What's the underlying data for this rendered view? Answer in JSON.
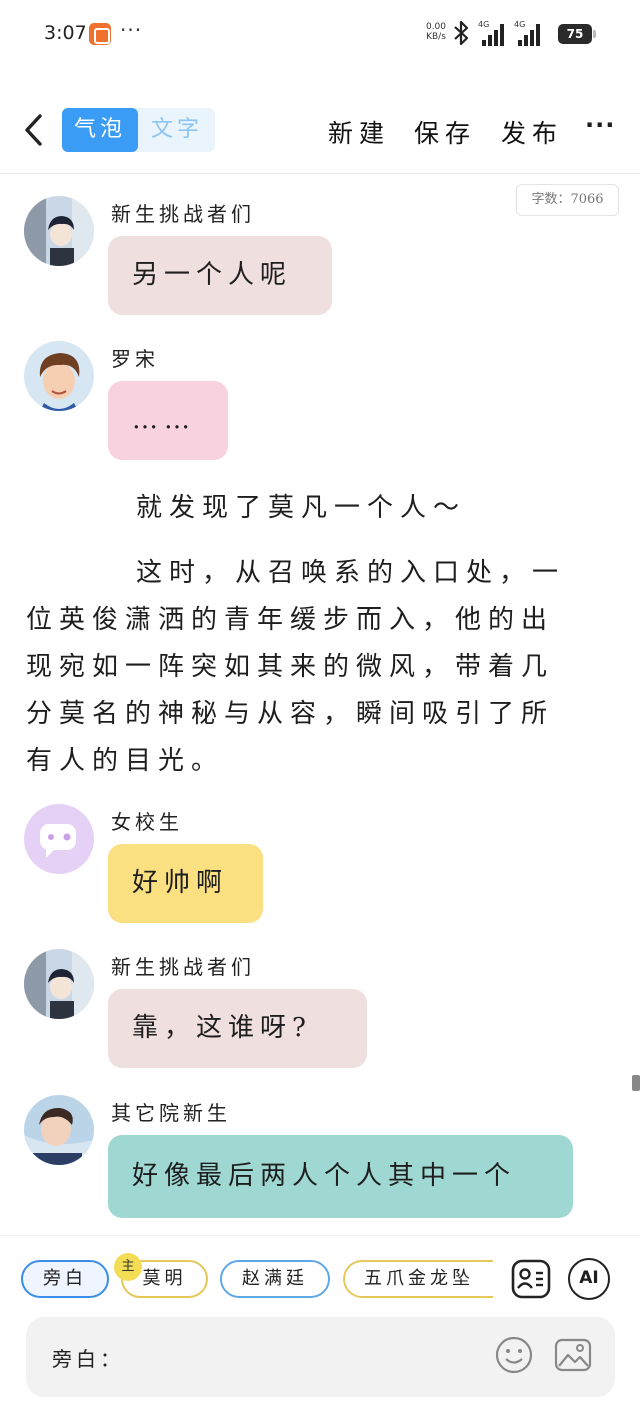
{
  "status_bar": {
    "time": "3:07",
    "more": "···",
    "net_speed": "0.00",
    "net_unit": "KB/s",
    "network_type_1": "4G",
    "network_type_2": "4G",
    "battery": "75",
    "icons": [
      "app-notification-icon",
      "bluetooth-icon",
      "signal-icon",
      "signal-icon",
      "battery-icon"
    ]
  },
  "toolbar": {
    "mode_bubble": "气泡",
    "mode_text": "文字",
    "new_label": "新建",
    "save_label": "保存",
    "publish_label": "发布",
    "more_label": "···"
  },
  "word_count": "字数：7066",
  "messages": [
    {
      "name": "新生挑战者们",
      "text": "另一个人呢",
      "bubble_color": "#f0dfdf"
    },
    {
      "name": "罗宋",
      "text": "……",
      "bubble_color": "#f8d3df"
    },
    {
      "name": "女校生",
      "text": "好帅啊",
      "bubble_color": "#fbe081"
    },
    {
      "name": "新生挑战者们",
      "text": "靠，这谁呀?",
      "bubble_color": "#f0dfdf"
    },
    {
      "name": "其它院新生",
      "text": "好像最后两人个人其中一个",
      "bubble_color": "#9fd8d2"
    }
  ],
  "narration": [
    "就发现了莫凡一个人～",
    "这时，从召唤系的入口处，一位英俊潇洒的青年缓步而入，他的出现宛如一阵突如其来的微风，带着几分莫名的神秘与从容，瞬间吸引了所有人的目光。"
  ],
  "characters": {
    "chip1": "旁白",
    "chip2": "莫明",
    "chip2_badge": "主",
    "chip3": "赵满廷",
    "chip4": "五爪金龙坠"
  },
  "buttons": {
    "ai_label": "AI"
  },
  "input": {
    "label": "旁白：",
    "value": ""
  },
  "colors": {
    "accent": "#3a9cf4",
    "toggle_bg": "#eaf4fd"
  }
}
